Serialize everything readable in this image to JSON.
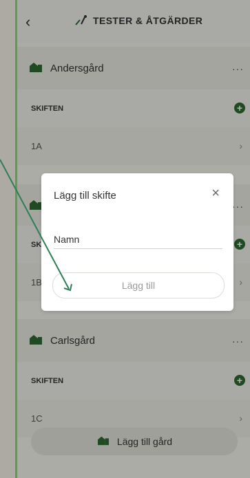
{
  "app": {
    "title": "TESTER & ÅTGÄRDER",
    "back_icon": "chevron-left-icon",
    "title_icon": "tools-icon"
  },
  "farms": [
    {
      "name": "Andersgård",
      "section_label": "SKIFTEN",
      "fields": [
        "1A"
      ]
    },
    {
      "name": "",
      "section_label": "SKI",
      "fields": [
        "1B"
      ]
    },
    {
      "name": "Carlsgård",
      "section_label": "SKIFTEN",
      "fields": [
        "1C"
      ]
    }
  ],
  "bottom_button": {
    "label": "Lägg till gård",
    "icon": "farm-icon"
  },
  "modal": {
    "title": "Lägg till skifte",
    "close_icon": "close-icon",
    "input_value": "Namn",
    "button_label": "Lägg till"
  },
  "colors": {
    "accent": "#2e6b31",
    "arrow": "#2f7d55",
    "side_border": "#9ccf8f"
  }
}
